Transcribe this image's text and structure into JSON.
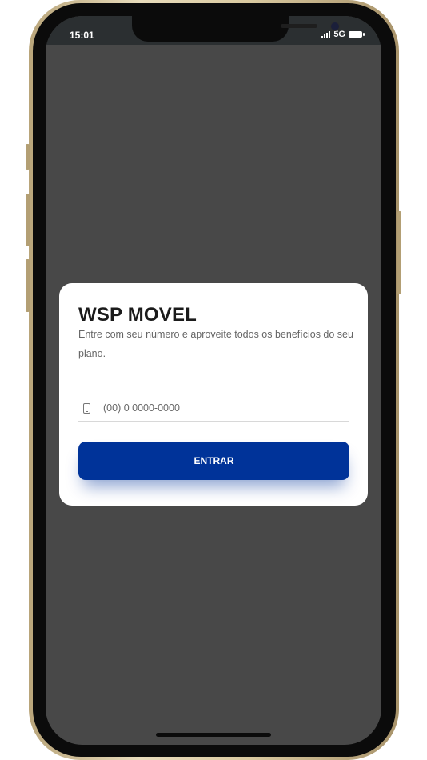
{
  "status_bar": {
    "time": "15:01",
    "network": "5G",
    "icons": [
      "signal-icon",
      "battery-icon"
    ]
  },
  "login_card": {
    "title": "WSP MOVEL",
    "description": "Entre com seu número e aproveite todos os benefícios do seu plano.",
    "phone_input": {
      "placeholder": "(00) 0 0000-0000",
      "value": "",
      "icon": "mobile-phone-icon"
    },
    "enter_button": {
      "label": "ENTRAR",
      "color": "#003399"
    }
  },
  "colors": {
    "screen_background": "#484848",
    "card_background": "#ffffff",
    "accent": "#003399"
  }
}
